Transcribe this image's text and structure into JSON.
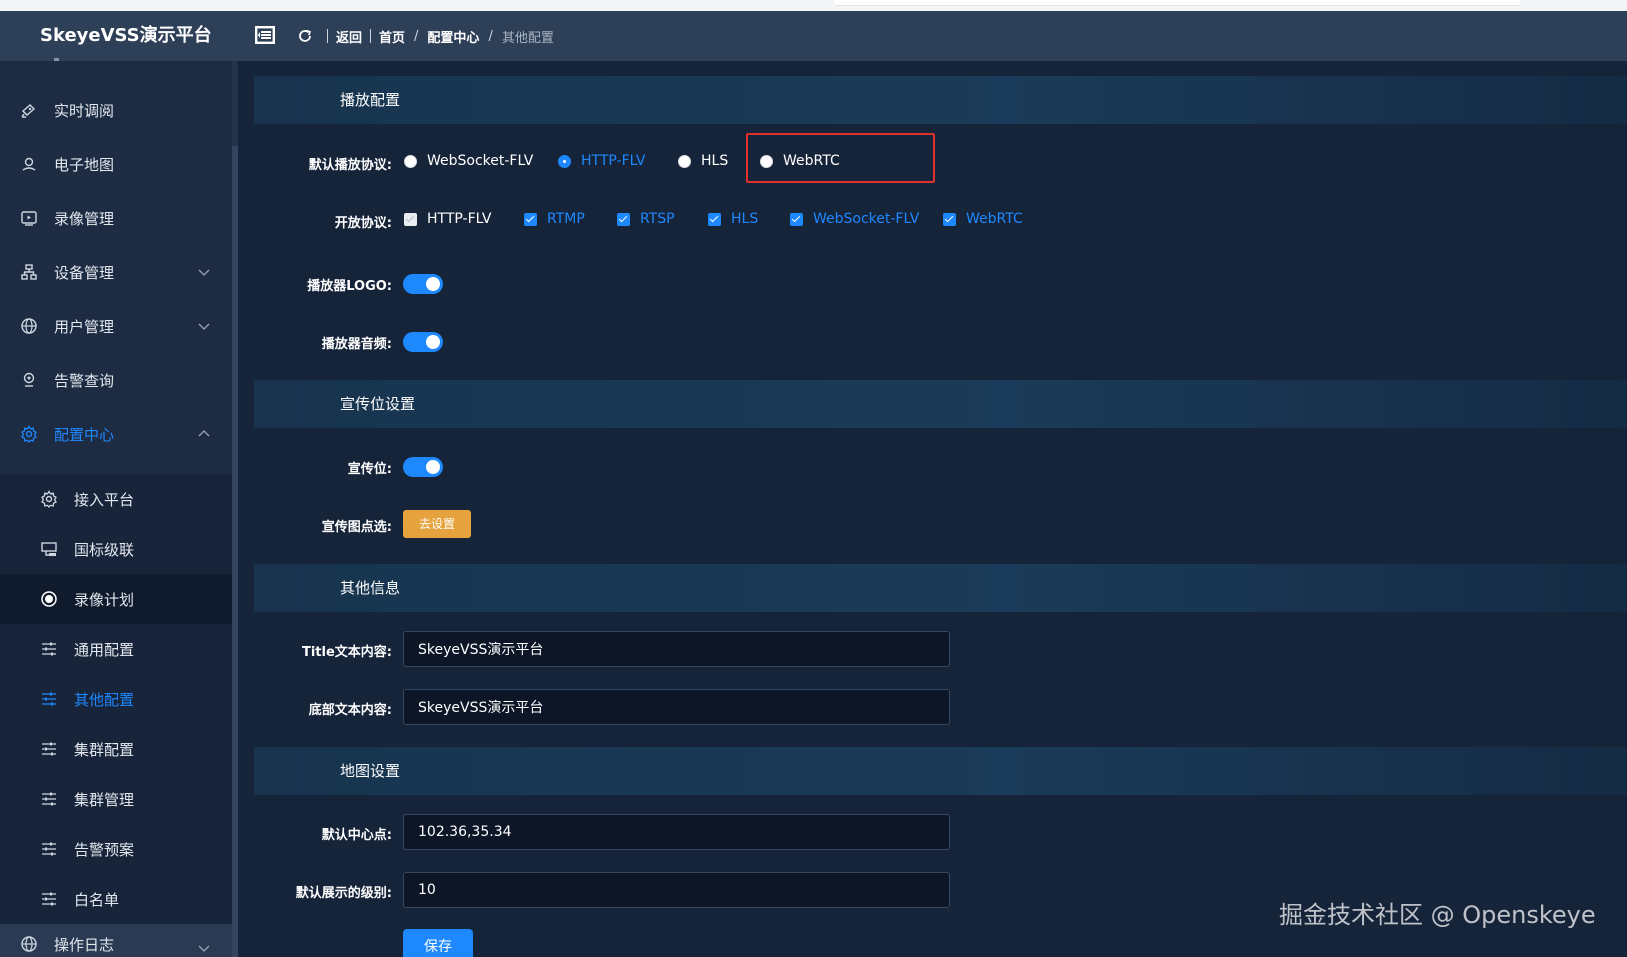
{
  "header": {
    "brand": "SkeyeVSS演示平台",
    "back": "返回",
    "breadcrumb": [
      "首页",
      "配置中心",
      "其他配置"
    ]
  },
  "sidebar": {
    "items": [
      {
        "label": "实时调阅",
        "icon": "video-camera-icon"
      },
      {
        "label": "电子地图",
        "icon": "map-pin-icon"
      },
      {
        "label": "录像管理",
        "icon": "record-icon"
      },
      {
        "label": "设备管理",
        "icon": "device-tree-icon"
      },
      {
        "label": "用户管理",
        "icon": "globe-icon"
      },
      {
        "label": "告警查询",
        "icon": "alarm-icon"
      },
      {
        "label": "配置中心",
        "icon": "gear-icon"
      }
    ],
    "sub_items": [
      {
        "label": "接入平台",
        "icon": "gear-icon"
      },
      {
        "label": "国标级联",
        "icon": "cascade-icon"
      },
      {
        "label": "录像计划",
        "icon": "record-plan-icon"
      },
      {
        "label": "通用配置",
        "icon": "sliders-icon"
      },
      {
        "label": "其他配置",
        "icon": "sliders-icon"
      },
      {
        "label": "集群配置",
        "icon": "sliders-icon"
      },
      {
        "label": "集群管理",
        "icon": "sliders-icon"
      },
      {
        "label": "告警预案",
        "icon": "sliders-icon"
      },
      {
        "label": "白名单",
        "icon": "sliders-icon"
      }
    ],
    "bottom_item": {
      "label": "操作日志",
      "icon": "globe-icon"
    },
    "active_color": "#1e88ff"
  },
  "play_config": {
    "section_title": "播放配置",
    "default_protocol_label": "默认播放协议:",
    "protocols": [
      "WebSocket-FLV",
      "HTTP-FLV",
      "HLS",
      "WebRTC"
    ],
    "selected_protocol": "HTTP-FLV",
    "open_protocol_label": "开放协议:",
    "open_protocols": [
      "HTTP-FLV",
      "RTMP",
      "RTSP",
      "HLS",
      "WebSocket-FLV",
      "WebRTC"
    ],
    "logo_label": "播放器LOGO:",
    "logo_on": true,
    "audio_label": "播放器音频:",
    "audio_on": true
  },
  "ad_config": {
    "section_title": "宣传位设置",
    "ad_label": "宣传位:",
    "ad_on": true,
    "image_label": "宣传图点选:",
    "set_button": "去设置"
  },
  "other_info": {
    "section_title": "其他信息",
    "title_label": "Title文本内容:",
    "title_value": "SkeyeVSS演示平台",
    "footer_label": "底部文本内容:",
    "footer_value": "SkeyeVSS演示平台"
  },
  "map_config": {
    "section_title": "地图设置",
    "center_label": "默认中心点:",
    "center_value": "102.36,35.34",
    "zoom_label": "默认展示的级别:",
    "zoom_value": "10",
    "save_button": "保存"
  },
  "watermark": "掘金技术社区 @ Openskeye",
  "colors": {
    "accent": "#1e88ff",
    "warning": "#e6a23c",
    "highlight": "#e0302e"
  }
}
